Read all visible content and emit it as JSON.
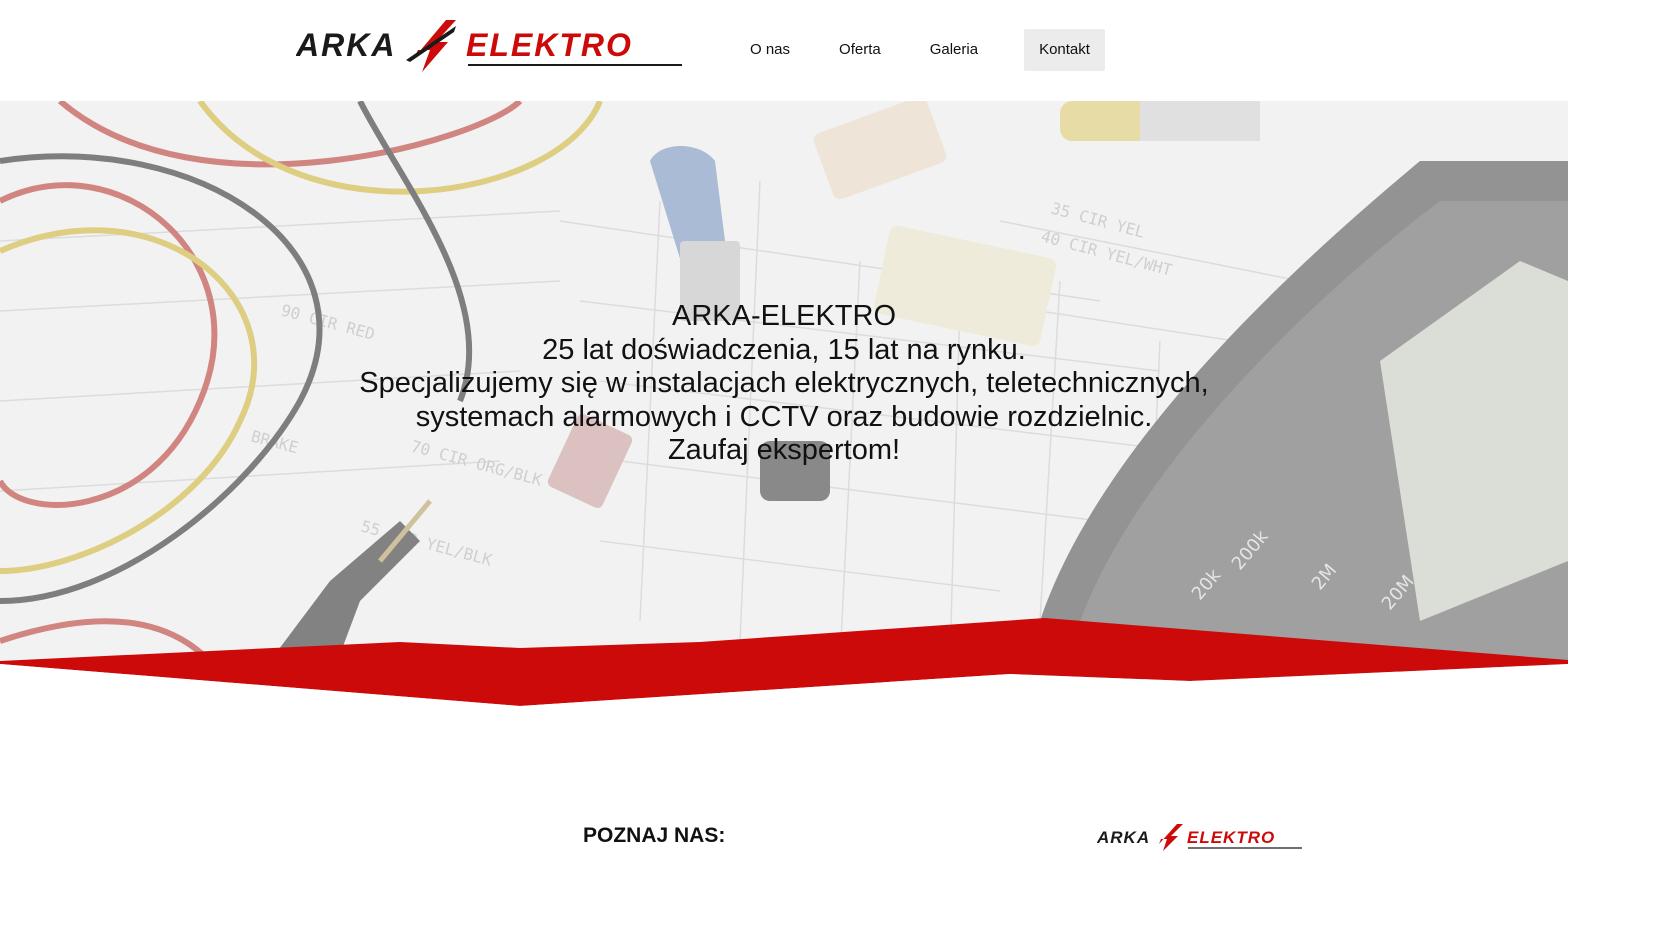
{
  "brand": {
    "logo_left": "ARKA",
    "logo_right": "ELEKTRO",
    "colors": {
      "red": "#cc0a0a",
      "dark": "#1a1a1a"
    }
  },
  "nav": {
    "items": [
      {
        "label": "O nas"
      },
      {
        "label": "Oferta"
      },
      {
        "label": "Galeria"
      },
      {
        "label": "Kontakt",
        "active": true
      }
    ]
  },
  "hero": {
    "lines": [
      "ARKA-ELEKTRO",
      "25 lat doświadczenia, 15 lat na rynku.",
      "Specjalizujemy się w instalacjach elektrycznych, teletechnicznych,",
      "systemach alarmowych i CCTV oraz budowie rozdzielnic.",
      "Zaufaj ekspertom!"
    ]
  },
  "about": {
    "title": "POZNAJ NAS:"
  }
}
